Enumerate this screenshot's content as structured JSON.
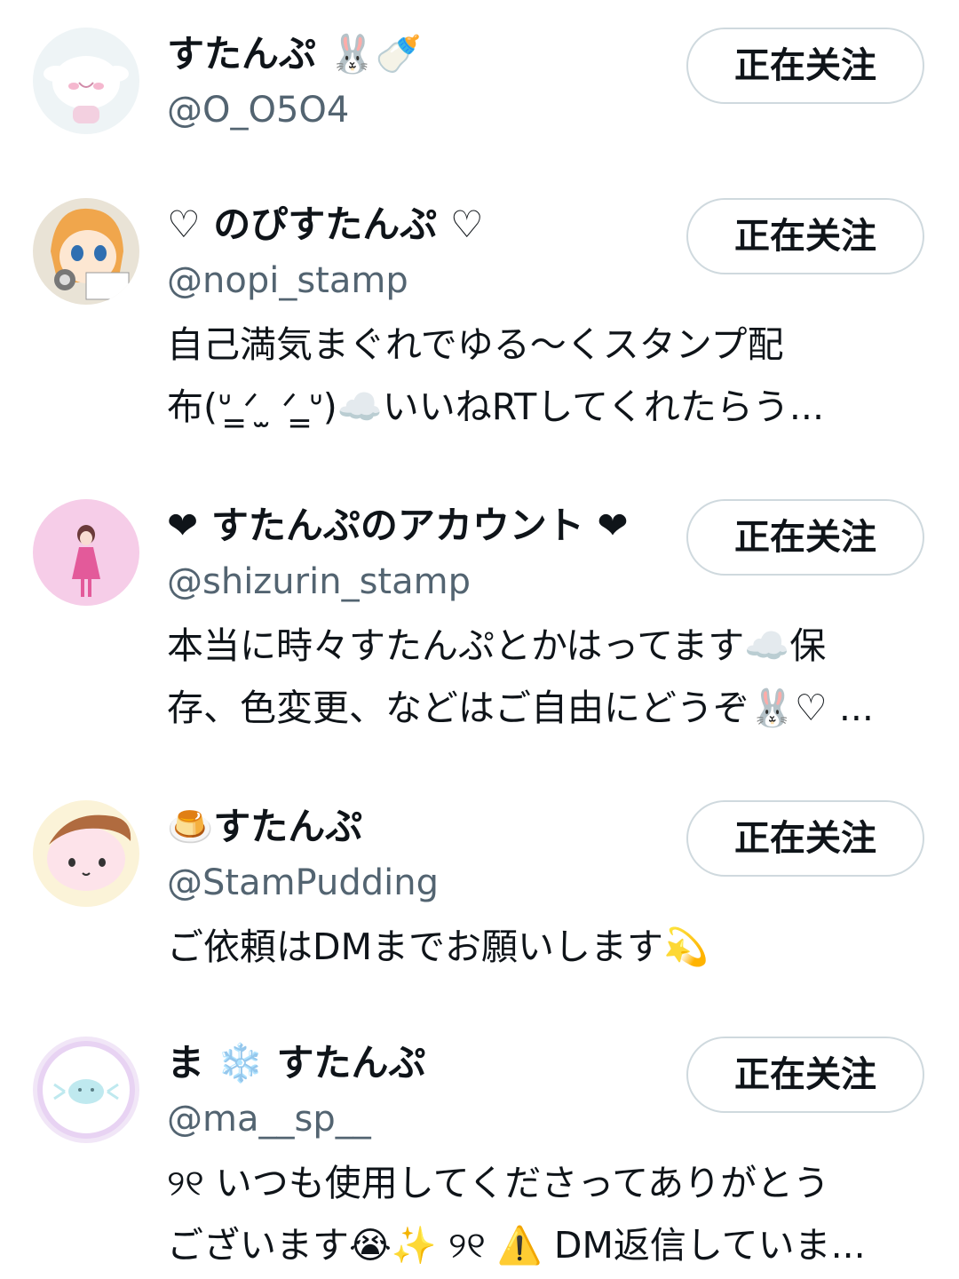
{
  "follow_button_label": "正在关注",
  "users": [
    {
      "display_name": "すたんぷ 🐰🍼",
      "handle": "@O_O5O4",
      "bio_lines": []
    },
    {
      "display_name": "♡ のぴすたんぷ ♡",
      "handle": "@nopi_stamp",
      "bio_lines": [
        "自己満気まぐれでゆる〜くスタンプ配",
        "布(ᐡ ̳ᐟ  ̫ ᐟ ̳ᐡ)☁️いいねRTしてくれたらう..."
      ]
    },
    {
      "display_name": "❤ すたんぷのアカウント ❤",
      "handle": "@shizurin_stamp",
      "bio_lines": [
        "本当に時々すたんぷとかはってます☁️保",
        "存、色変更、などはご自由にどうぞ🐰♡ ..."
      ]
    },
    {
      "display_name": "🍮すたんぷ",
      "handle": "@StamPudding",
      "bio_lines": [
        "ご依頼はDMまでお願いします💫"
      ]
    },
    {
      "display_name": "ま ❄️ すたんぷ",
      "handle": "@ma__sp__",
      "bio_lines": [
        "୨୧ いつも使用してくださってありがとう",
        "ございます😭✨ ୨୧ ⚠️ DM返信していま..."
      ]
    }
  ]
}
